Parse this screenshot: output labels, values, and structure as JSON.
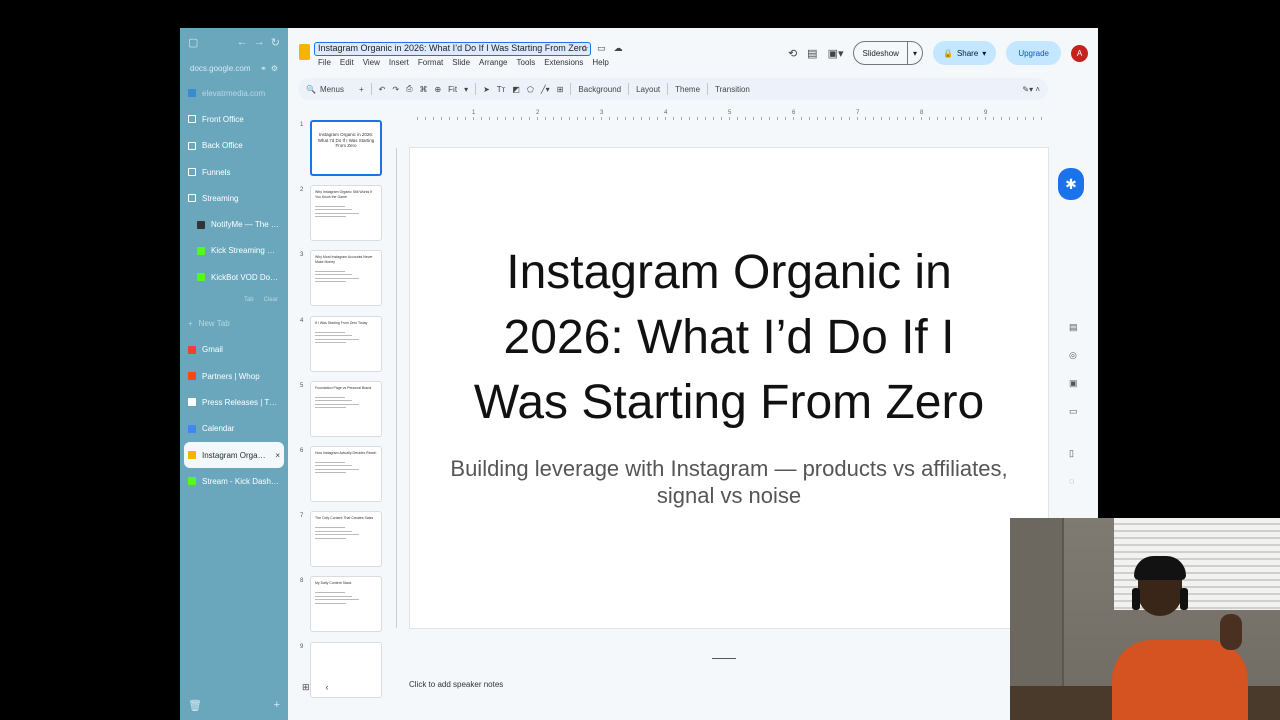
{
  "sidebar": {
    "url": "docs.google.com",
    "workspace": "elevatrmedia.com",
    "items": [
      {
        "label": "Front Office",
        "type": "folder"
      },
      {
        "label": "Back Office",
        "type": "folder"
      },
      {
        "label": "Funnels",
        "type": "folder"
      },
      {
        "label": "Streaming",
        "type": "folder"
      },
      {
        "label": "NotifyMe — The Label",
        "type": "sub",
        "color": "#333333"
      },
      {
        "label": "Kick Streaming Platf...",
        "type": "sub",
        "color": "#53fc18"
      },
      {
        "label": "KickBot VOD Downlo...",
        "type": "sub",
        "color": "#53fc18"
      }
    ],
    "mini_actions": [
      "Tab",
      "Clear"
    ],
    "new_tab": "New Tab",
    "tabs": [
      {
        "label": "Gmail",
        "color": "#ea4335"
      },
      {
        "label": "Partners | Whop",
        "color": "#fa4616"
      },
      {
        "label": "Press Releases | The Of...",
        "color": "#ffffff"
      },
      {
        "label": "Calendar",
        "color": "#4285f4"
      },
      {
        "label": "Instagram Organic i...",
        "color": "#f6b400",
        "active": true
      },
      {
        "label": "Stream - Kick Dashboard",
        "color": "#53fc18"
      }
    ]
  },
  "doc": {
    "title": "Instagram Organic in 2026: What I’d Do If I Was Starting From Zero",
    "menus": [
      "File",
      "Edit",
      "View",
      "Insert",
      "Format",
      "Slide",
      "Arrange",
      "Tools",
      "Extensions",
      "Help"
    ]
  },
  "header": {
    "slideshow": "Slideshow",
    "share": "Share",
    "upgrade": "Upgrade",
    "avatar": "A"
  },
  "toolbar": {
    "menus": "Menus",
    "zoom": "Fit",
    "background": "Background",
    "layout": "Layout",
    "theme": "Theme",
    "transition": "Transition"
  },
  "ruler": {
    "labels": [
      "1",
      "2",
      "3",
      "4",
      "5",
      "6",
      "7",
      "8",
      "9"
    ]
  },
  "filmstrip": [
    {
      "num": "1",
      "title": "Instagram Organic in 2026: What I’d Do If I Was Starting From Zero",
      "selected": true
    },
    {
      "num": "2",
      "title": "Why Instagram Organic Still Works If You Know the Game"
    },
    {
      "num": "3",
      "title": "Why Most Instagram Accounts Never Make Money"
    },
    {
      "num": "4",
      "title": "If I Was Starting From Zero Today"
    },
    {
      "num": "5",
      "title": "Foundation Page vs Personal Brand"
    },
    {
      "num": "6",
      "title": "How Instagram Actually Decides Reach"
    },
    {
      "num": "7",
      "title": "The Only Content That Creates Sales"
    },
    {
      "num": "8",
      "title": "My Daily Content Stack"
    },
    {
      "num": "9",
      "title": ""
    }
  ],
  "slide": {
    "title": "Instagram Organic in 2026: What I’d Do If I Was Starting From Zero",
    "subtitle": "Building leverage with Instagram — products vs affiliates, signal vs noise"
  },
  "notes": {
    "placeholder": "Click to add speaker notes"
  }
}
